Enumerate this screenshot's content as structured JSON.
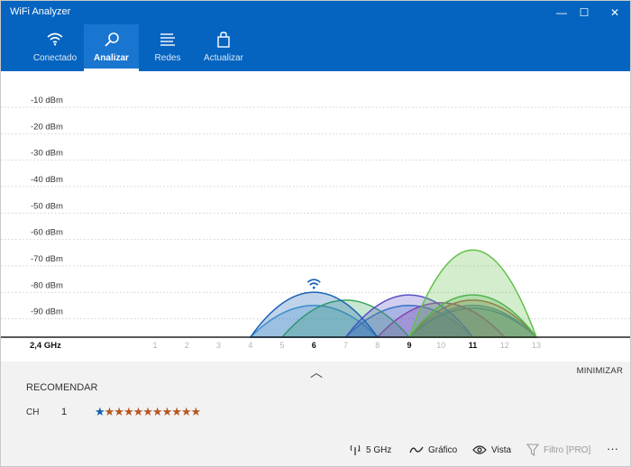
{
  "window": {
    "title": "WiFi Analyzer",
    "minimize_glyph": "—",
    "maximize_glyph": "☐",
    "close_glyph": "✕"
  },
  "nav": {
    "tabs": [
      {
        "label": "Conectado",
        "icon": "wifi-icon",
        "active": false
      },
      {
        "label": "Analizar",
        "icon": "magnifier-icon",
        "active": true
      },
      {
        "label": "Redes",
        "icon": "list-icon",
        "active": false
      },
      {
        "label": "Actualizar",
        "icon": "bag-icon",
        "active": false
      }
    ]
  },
  "chart_data": {
    "type": "area",
    "band": "2,4 GHz",
    "y_tick_labels": [
      "-10 dBm",
      "-20 dBm",
      "-30 dBm",
      "-40 dBm",
      "-50 dBm",
      "-60 dBm",
      "-70 dBm",
      "-80 dBm",
      "-90 dBm"
    ],
    "ylim": [
      -100,
      -10
    ],
    "x_ticks": [
      "1",
      "2",
      "3",
      "4",
      "5",
      "6",
      "7",
      "8",
      "9",
      "10",
      "11",
      "12",
      "13"
    ],
    "bold_channels": [
      "6",
      "9",
      "11"
    ],
    "connected_channel": 6,
    "grid": "horizontal dotted",
    "networks": [
      {
        "channel": 6,
        "signal_dbm": -83,
        "color": "#1a63b5"
      },
      {
        "channel": 6,
        "signal_dbm": -88,
        "color": "#4f9fd4"
      },
      {
        "channel": 7,
        "signal_dbm": -86,
        "color": "#38a85a"
      },
      {
        "channel": 9,
        "signal_dbm": -84,
        "color": "#5a4fc8"
      },
      {
        "channel": 9,
        "signal_dbm": -88,
        "color": "#3a86c8"
      },
      {
        "channel": 10,
        "signal_dbm": -87,
        "color": "#9a3fa8"
      },
      {
        "channel": 11,
        "signal_dbm": -67,
        "color": "#62c04a"
      },
      {
        "channel": 11,
        "signal_dbm": -84,
        "color": "#4caf50"
      },
      {
        "channel": 11,
        "signal_dbm": -86,
        "color": "#c0504a"
      },
      {
        "channel": 11,
        "signal_dbm": -88,
        "color": "#3f8fc8"
      },
      {
        "channel": 11,
        "signal_dbm": -89,
        "color": "#2a6fa8"
      }
    ]
  },
  "panel": {
    "collapse_glyph": "︿",
    "minimize_label": "MINIMIZAR",
    "recommend_title": "RECOMENDAR",
    "ch_label": "CH",
    "ch_value": "1",
    "stars_blue": "★",
    "stars_orange": "★★★★★★★★★★",
    "rating_filled": 1,
    "rating_total": 11
  },
  "toolbar": {
    "band_label": "5 GHz",
    "graph_label": "Gráfico",
    "view_label": "Vista",
    "filter_label": "Filtro [PRO]",
    "more_label": "···"
  },
  "colors": {
    "accent": "#0564c0",
    "active_tab": "#1a75d0",
    "panel_bg": "#f2f2f2"
  }
}
